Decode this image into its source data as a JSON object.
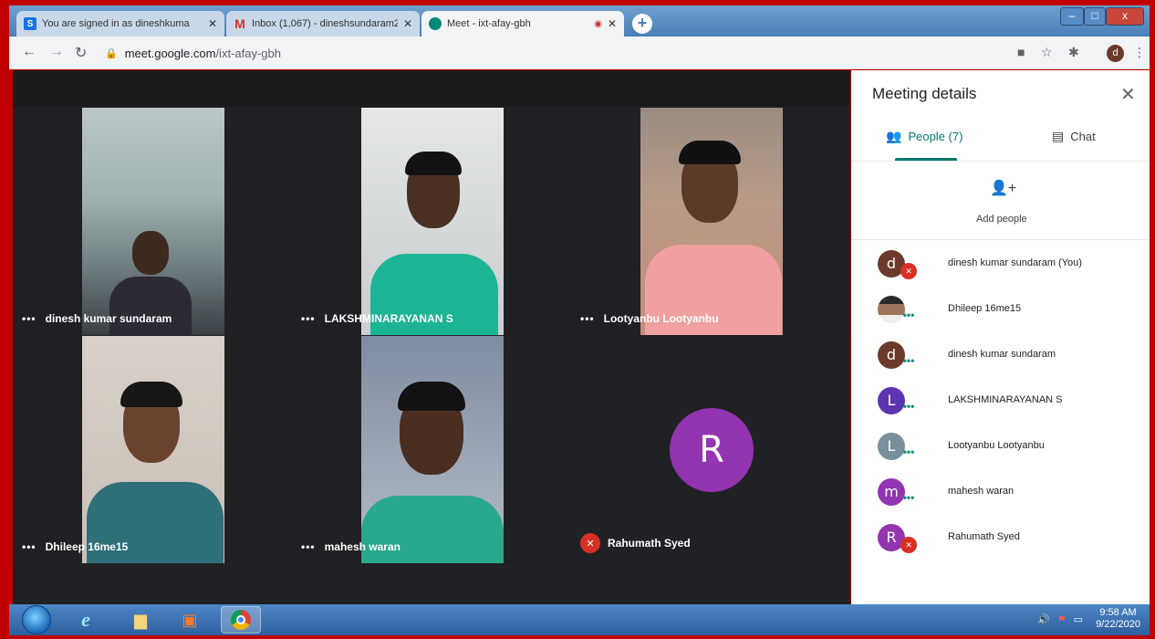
{
  "browser": {
    "tabs": [
      {
        "title": "You are signed in as dineshkuma",
        "favicon": "S",
        "favicon_color": "#1a73e8"
      },
      {
        "title": "Inbox (1,067) - dineshsundaram2",
        "favicon": "M",
        "favicon_color": "#d93025"
      },
      {
        "title": "Meet - ixt-afay-gbh",
        "favicon": "meet",
        "favicon_color": "#00897b"
      }
    ],
    "new_tab": "+",
    "url_host": "meet.google.com",
    "url_path": "/ixt-afay-gbh",
    "profile_initial": "d",
    "window_buttons": {
      "minimize": "–",
      "maximize": "□",
      "close": "x"
    }
  },
  "meet": {
    "tiles": [
      {
        "name": "dinesh kumar sundaram",
        "muted": false
      },
      {
        "name": "LAKSHMINARAYANAN S",
        "muted": false
      },
      {
        "name": "Lootyanbu Lootyanbu",
        "muted": false
      },
      {
        "name": "Dhileep 16me15",
        "muted": false
      },
      {
        "name": "mahesh waran",
        "muted": false
      },
      {
        "name": "Rahumath Syed",
        "muted": true,
        "avatar_initial": "R"
      }
    ],
    "more_dots": "•••"
  },
  "panel": {
    "title": "Meeting details",
    "close": "✕",
    "tab_people": "People (7)",
    "tab_chat": "Chat",
    "add_people": "Add people",
    "people": [
      {
        "initial": "d",
        "name": "dinesh kumar sundaram (You)",
        "color": "#6b3a2a",
        "status": "muted"
      },
      {
        "initial": "",
        "name": "Dhileep 16me15",
        "color": "#c7a48a",
        "status": "more"
      },
      {
        "initial": "d",
        "name": "dinesh kumar sundaram",
        "color": "#6b3a2a",
        "status": "more"
      },
      {
        "initial": "L",
        "name": "LAKSHMINARAYANAN S",
        "color": "#5e35b1",
        "status": "more"
      },
      {
        "initial": "L",
        "name": "Lootyanbu Lootyanbu",
        "color": "#78909c",
        "status": "more"
      },
      {
        "initial": "m",
        "name": "mahesh waran",
        "color": "#9334b0",
        "status": "more"
      },
      {
        "initial": "R",
        "name": "Rahumath Syed",
        "color": "#9334b0",
        "status": "muted"
      }
    ]
  },
  "taskbar": {
    "time": "9:58 AM",
    "date": "9/22/2020"
  }
}
